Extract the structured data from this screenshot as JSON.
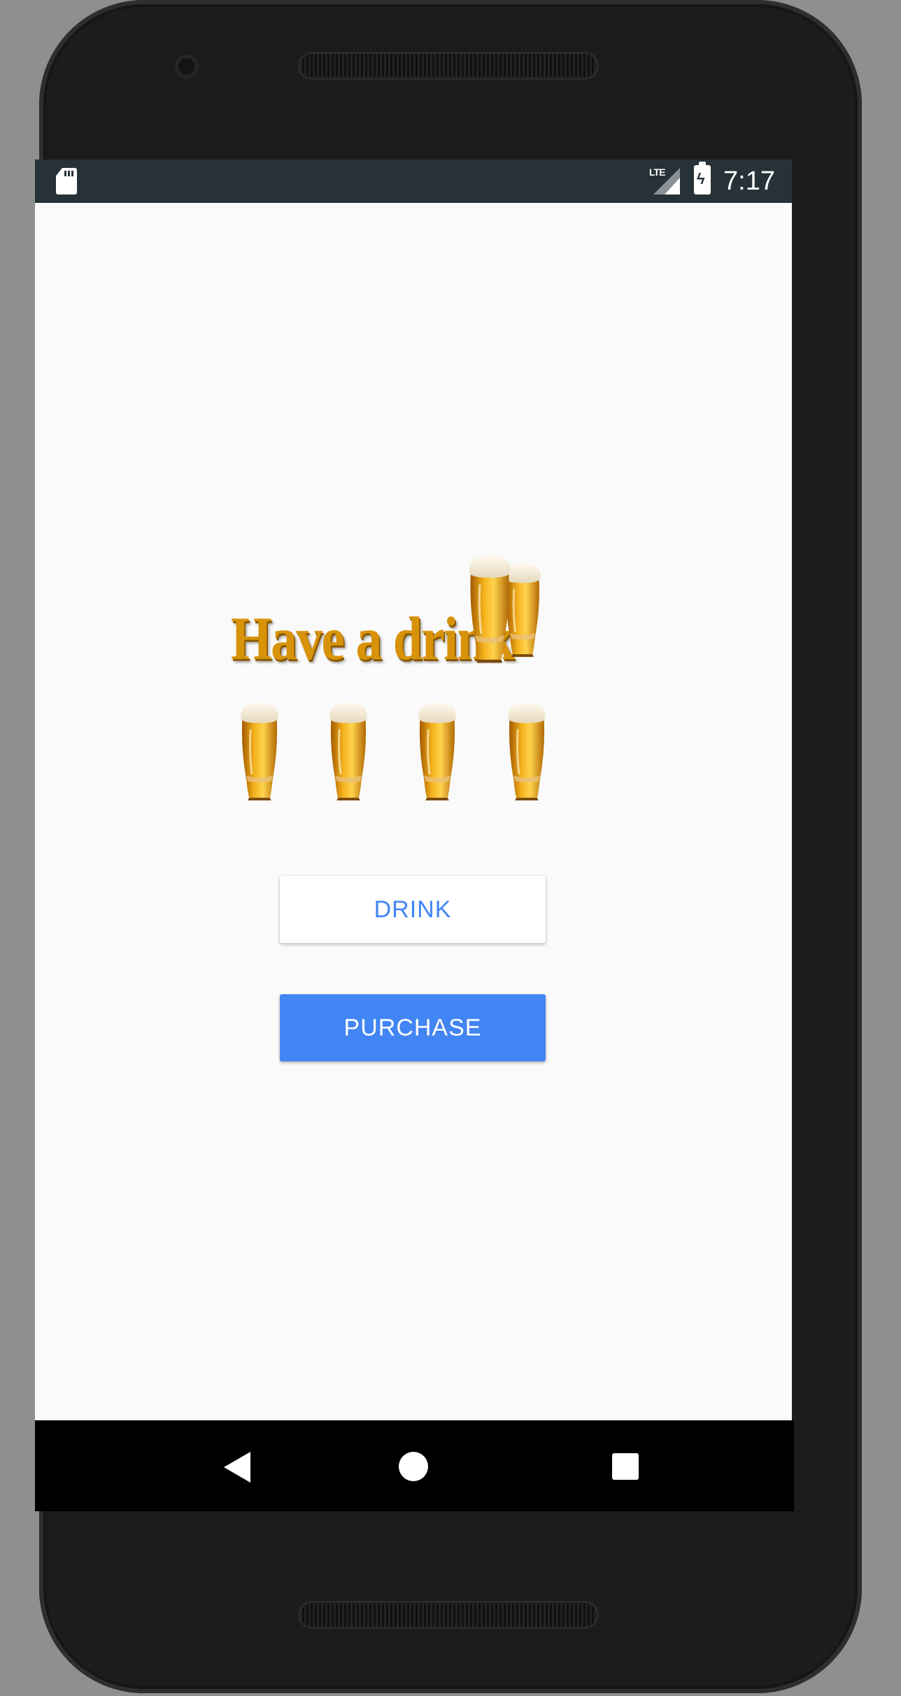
{
  "status_bar": {
    "time": "7:17",
    "network_label": "LTE",
    "icons": [
      "sd-card-icon",
      "lte-signal-icon",
      "battery-charging-icon"
    ]
  },
  "logo": {
    "text": "Have a drink",
    "color": "#d8930a"
  },
  "beer_glasses": {
    "count": 4,
    "icon": "beer-glass-icon"
  },
  "buttons": {
    "drink_label": "DRINK",
    "purchase_label": "PURCHASE"
  },
  "navigation": {
    "back": "back-icon",
    "home": "home-icon",
    "recents": "recents-icon"
  },
  "colors": {
    "accent": "#4285f4",
    "status_bar": "#263238",
    "screen_bg": "#fafafa"
  }
}
